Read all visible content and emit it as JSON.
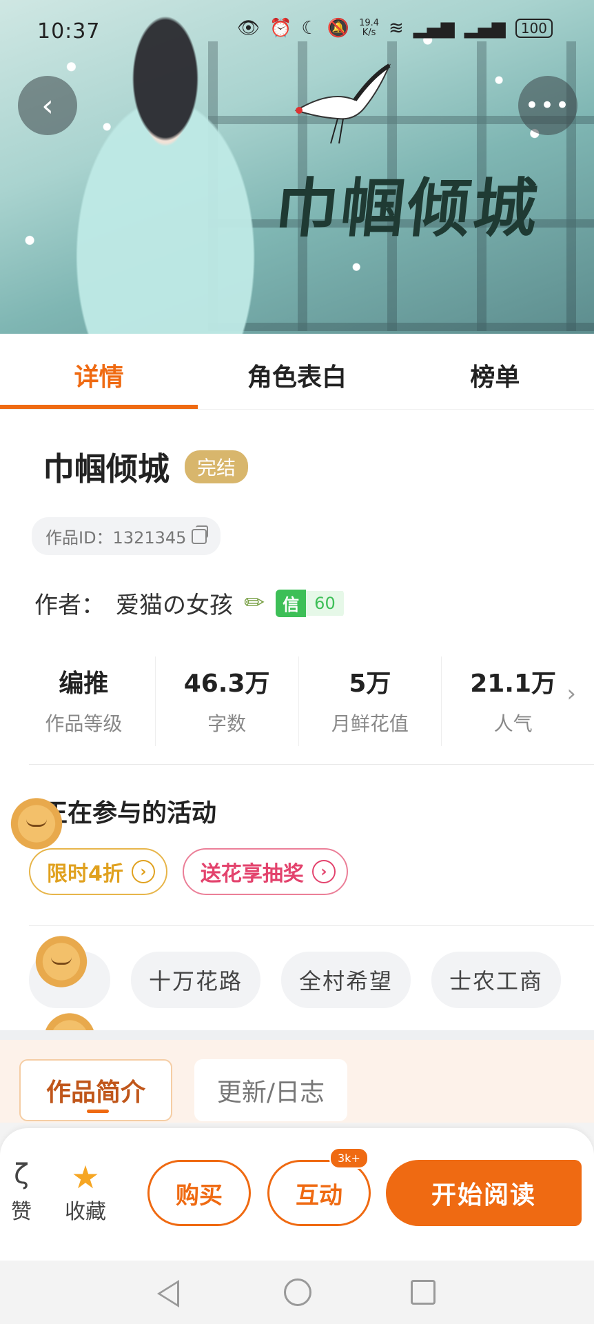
{
  "status_bar": {
    "time": "10:37",
    "net_speed_value": "19.4",
    "net_speed_unit": "K/s",
    "battery": "100",
    "icons": [
      "eye-icon",
      "alarm-icon",
      "moon-icon",
      "mute-icon",
      "wifi-icon",
      "signal-icon",
      "signal-icon",
      "battery-icon"
    ]
  },
  "hero": {
    "cover_title": "巾帼倾城",
    "back_icon": "chevron-left-icon",
    "more_icon": "more-icon"
  },
  "tabs": [
    {
      "label": "详情",
      "active": true
    },
    {
      "label": "角色表白",
      "active": false
    },
    {
      "label": "榜单",
      "active": false
    }
  ],
  "book": {
    "title": "巾帼倾城",
    "status": "完结",
    "id_text": "作品ID：1321345",
    "author_label": "作者：",
    "author_name": "爱猫の女孩",
    "trust_key": "信",
    "trust_value": "60"
  },
  "stats": [
    {
      "value": "编推",
      "label": "作品等级"
    },
    {
      "value": "46.3万",
      "label": "字数"
    },
    {
      "value": "5万",
      "label": "月鲜花值"
    },
    {
      "value": "21.1万",
      "label": "人气"
    }
  ],
  "activities": {
    "title": "正在参与的活动",
    "items": [
      {
        "label": "限时4折",
        "style": "gold"
      },
      {
        "label": "送花享抽奖",
        "style": "pink"
      }
    ]
  },
  "tags": [
    "十万花路",
    "全村希望",
    "士农工商"
  ],
  "intro_tabs": [
    {
      "label": "作品简介",
      "active": true
    },
    {
      "label": "更新/日志",
      "active": false
    }
  ],
  "bottom_bar": {
    "like_label": "赞",
    "fav_label": "收藏",
    "buy_label": "购买",
    "interact_label": "互动",
    "interact_badge": "3k+",
    "read_label": "开始阅读"
  },
  "colors": {
    "accent": "#ef6a12",
    "badge_gold": "#d8b66c",
    "trust_green": "#3dbf57",
    "intro_bg": "#fdf2ea"
  }
}
